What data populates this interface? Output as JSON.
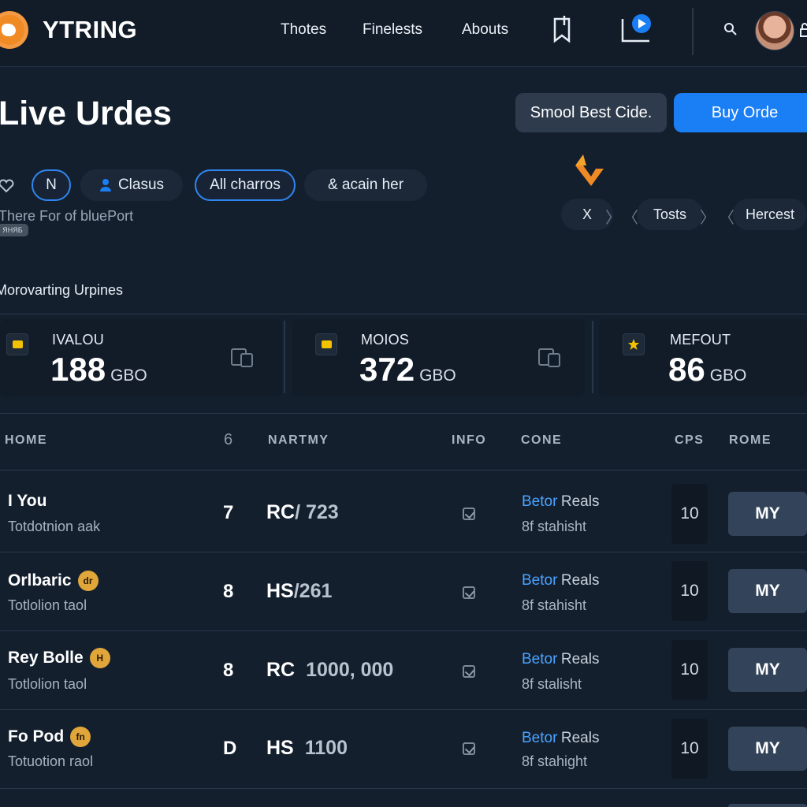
{
  "nav": {
    "brand": "YTRING",
    "links": [
      "Thotes",
      "Finelests",
      "Abouts"
    ]
  },
  "header": {
    "title": "Live Urdes",
    "secondary_button": "Smool Best Cide.",
    "primary_button": "Buy Orde"
  },
  "filters": {
    "chip_n": "N",
    "chip_clasus": "Clasus",
    "chip_all": "All charros",
    "chip_again": "& acain her",
    "subtext": "There For of bluePort",
    "badge": "ЯНЯБ"
  },
  "pager": {
    "close": "X",
    "tosts": "Tosts",
    "hercest": "Hercest"
  },
  "section_title": "Morovarting Urpines",
  "stats": [
    {
      "label": "IVALOU",
      "value": "188",
      "unit": "GBO"
    },
    {
      "label": "MOIOS",
      "value": "372",
      "unit": "GBO"
    },
    {
      "label": "MEFOUT",
      "value": "86",
      "unit": "GBO"
    }
  ],
  "table": {
    "headers": {
      "home": "HOME",
      "icon": "6",
      "nartmy": "NARTMY",
      "info": "INFO",
      "cone": "CONE",
      "cps": "CPS",
      "rome": "ROME"
    },
    "rows": [
      {
        "name": "I You",
        "badge": "",
        "sub": "Totdotnion aak",
        "num": "7",
        "code": "RC",
        "code_value": "/ 723",
        "cone_a": "Betor",
        "cone_b": "Reals",
        "cone_c": "8f stahisht",
        "cps": "10",
        "role": "MY"
      },
      {
        "name": "Orlbaric",
        "badge": "dr",
        "sub": "Totlolion taol",
        "num": "8",
        "code": "HS",
        "code_value": "/261",
        "cone_a": "Betor",
        "cone_b": "Reals",
        "cone_c": "8f stahisht",
        "cps": "10",
        "role": "MY"
      },
      {
        "name": "Rey Bolle",
        "badge": "H",
        "sub": "Totlolion taol",
        "num": "8",
        "code": "RC",
        "code_value": "1000, 000",
        "cone_a": "Betor",
        "cone_b": "Reals",
        "cone_c": "8f stalisht",
        "cps": "10",
        "role": "MY"
      },
      {
        "name": "Fo Pod",
        "badge": "fn",
        "sub": "Totuotion raol",
        "num": "D",
        "code": "HS",
        "code_value": "1100",
        "cone_a": "Betor",
        "cone_b": "Reals",
        "cone_c": "8f stahight",
        "cps": "10",
        "role": "MY"
      }
    ]
  },
  "colors": {
    "accent": "#1a7ef5",
    "badge": "#e0a63a",
    "highlight": "#f08a24",
    "link": "#4aa3ff"
  },
  "icons": [
    "logo-icon",
    "bookmark-icon",
    "video-play-icon",
    "search-icon",
    "lock-icon",
    "heart-icon",
    "user-icon",
    "arrow-logo-icon",
    "chevron-icon",
    "calendar-icon",
    "star-icon",
    "checkbox-icon"
  ]
}
